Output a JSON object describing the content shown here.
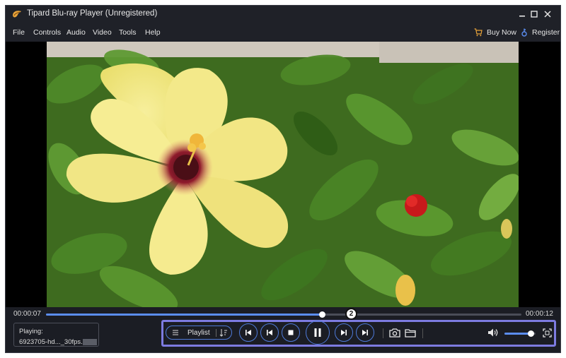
{
  "window": {
    "title": "Tipard Blu-ray Player (Unregistered)"
  },
  "menu": {
    "items": [
      "File",
      "Controls",
      "Audio",
      "Video",
      "Tools",
      "Help"
    ],
    "buy_label": "Buy Now",
    "register_label": "Register"
  },
  "playback": {
    "current_time": "00:00:07",
    "total_time": "00:00:12",
    "progress_fraction": 0.58,
    "volume_fraction": 0.85,
    "callout_number": "2"
  },
  "now_playing": {
    "label": "Playing:",
    "filename": "6923705-hd..._30fps."
  },
  "controls": {
    "playlist_label": "Playlist"
  },
  "colors": {
    "accent": "#5b8df0",
    "highlight_frame": "#7d7be0",
    "background": "#1b1d24"
  },
  "icons": {
    "logo": "tipard-logo-icon",
    "minimize": "minimize-icon",
    "maximize": "maximize-icon",
    "close": "close-icon",
    "buy": "cart-icon",
    "register": "key-icon",
    "playlist": "list-icon",
    "sort": "sort-icon",
    "previous": "skip-previous-icon",
    "rewind": "rewind-icon",
    "stop": "stop-icon",
    "pause": "pause-icon",
    "forward": "fast-forward-icon",
    "next": "skip-next-icon",
    "snapshot": "camera-icon",
    "open_folder": "folder-icon",
    "volume": "volume-icon",
    "fullscreen": "fullscreen-icon"
  }
}
